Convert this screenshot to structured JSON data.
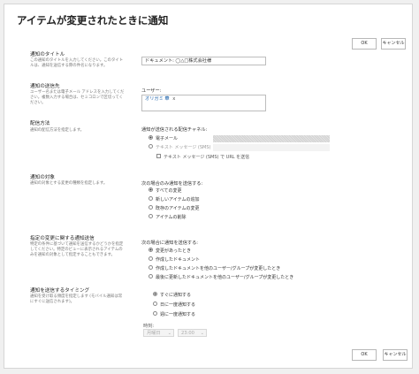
{
  "page": {
    "title": "アイテムが変更されたときに通知"
  },
  "buttons": {
    "ok": "OK",
    "cancel": "キャンセル"
  },
  "title_section": {
    "heading": "通知のタイトル",
    "description": "この通知のタイトルを入力してください。このタイトルは、通知を送信する際の件名になります。",
    "value": "ドキュメント: ◯△□株式会社様"
  },
  "recipients_section": {
    "heading": "通知の送信先",
    "description": "ユーザー名または電子メール アドレスを入力してください。複数入力する場合は、セミコロンで区切ってください。",
    "users_label": "ユーザー:",
    "user_chip": "オリガミ 華",
    "chip_remove": "x"
  },
  "delivery_section": {
    "heading": "配信方法",
    "description": "通知の配信方法を指定します。",
    "channel_label": "通知が送信される配信チャネル:",
    "options": [
      "電子メール",
      "テキスト メッセージ (SMS)"
    ],
    "selected": 0,
    "url_checkbox": "テキスト メッセージ (SMS) で URL を送信"
  },
  "target_section": {
    "heading": "通知の対象",
    "description": "通知の対象とする変更の種類を指定します。",
    "prompt": "次の場合のみ通知を送信する:",
    "options": [
      "すべての変更",
      "新しいアイテムの追加",
      "既存のアイテムの変更",
      "アイテムの削除"
    ],
    "selected": 0
  },
  "filter_section": {
    "heading": "指定の変更に関する通知送信",
    "description": "特定の条件に基づいて通知を送信するかどうかを指定してください。特定のビューに表示されるアイテムのみを通知の対象として指定することもできます。",
    "prompt": "次の場合に通知を送信する:",
    "options": [
      "変更があったとき",
      "作成したドキュメント",
      "作成したドキュメントを他のユーザー/グループが変更したとき",
      "最後に更新したドキュメントを他のユーザー/グループが変更したとき"
    ],
    "selected": 0
  },
  "timing_section": {
    "heading": "通知を送信するタイミング",
    "description": "通知を受け取る頻度を指定します (モバイル通知は常にすぐに送信されます)。",
    "options": [
      "すぐに通知する",
      "日に一度通知する",
      "週に一度通知する"
    ],
    "selected": 0,
    "time_label": "時刻:",
    "day_select": "月曜日",
    "time_select": "23:00"
  },
  "icons": {
    "dropdown": "chevron-down-icon"
  }
}
